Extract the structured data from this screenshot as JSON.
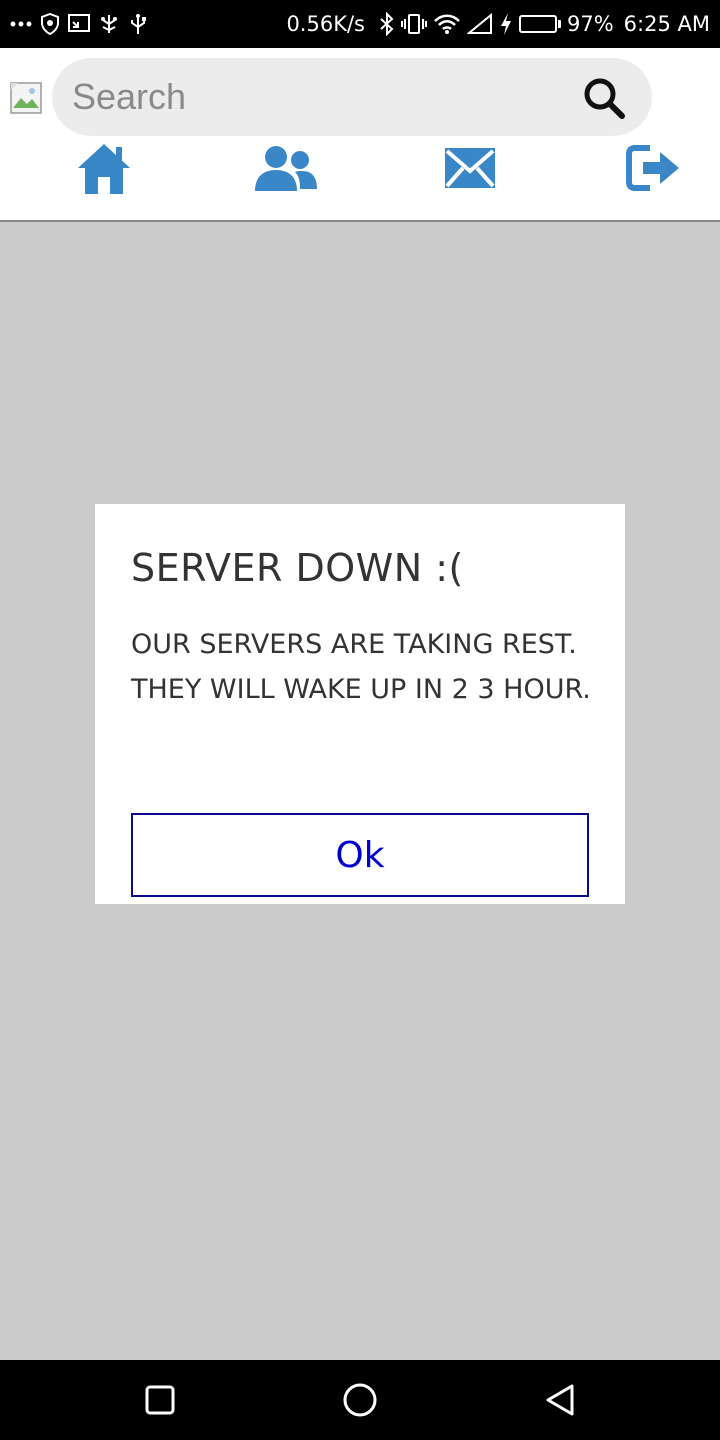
{
  "status_bar": {
    "network_speed": "0.56K/s",
    "battery_percent": "97%",
    "battery_level": 0.97,
    "time": "6:25 AM",
    "left_icons": [
      "more-icon",
      "shield-icon",
      "cast-icon",
      "usb-debug-icon",
      "usb-icon"
    ],
    "right_icons": [
      "bluetooth-icon",
      "vibrate-icon",
      "wifi-icon",
      "signal-icon",
      "charging-icon"
    ]
  },
  "header": {
    "logo_icon": "broken-image-icon",
    "search": {
      "placeholder": "Search",
      "value": ""
    },
    "nav": [
      {
        "icon": "home-icon"
      },
      {
        "icon": "people-icon"
      },
      {
        "icon": "mail-icon"
      },
      {
        "icon": "logout-icon"
      }
    ],
    "accent_color": "#3a87c8"
  },
  "dialog": {
    "title": "SERVER DOWN :(",
    "message": "OUR SERVERS ARE TAKING REST. THEY WILL WAKE UP IN 2 3 HOUR.",
    "ok_label": "Ok"
  },
  "system_nav": {
    "buttons": [
      "recents-icon",
      "home-circle-icon",
      "back-icon"
    ]
  },
  "colors": {
    "overlay": "#cbcbcb",
    "ok_text": "#0000cc",
    "ok_border": "#0a0a8c"
  }
}
